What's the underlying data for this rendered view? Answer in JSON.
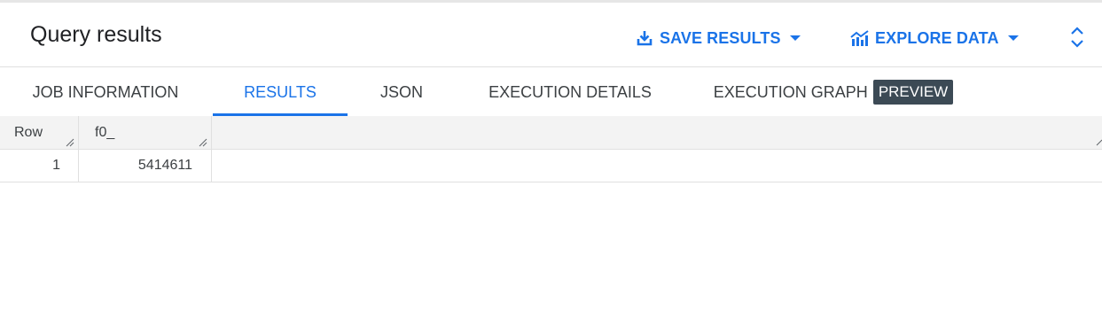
{
  "header": {
    "title": "Query results",
    "save_label": "SAVE RESULTS",
    "explore_label": "EXPLORE DATA"
  },
  "tabs": [
    {
      "label": "JOB INFORMATION",
      "active": false
    },
    {
      "label": "RESULTS",
      "active": true
    },
    {
      "label": "JSON",
      "active": false
    },
    {
      "label": "EXECUTION DETAILS",
      "active": false
    },
    {
      "label": "EXECUTION GRAPH",
      "active": false,
      "badge": "PREVIEW"
    }
  ],
  "table": {
    "columns": [
      "Row",
      "f0_"
    ],
    "rows": [
      [
        "1",
        "5414611"
      ]
    ]
  },
  "icons": {
    "save": "download-icon",
    "explore": "chart-icon",
    "expand": "unfold-icon"
  },
  "colors": {
    "accent": "#1a73e8",
    "badge_bg": "#3c4a55",
    "header_bg": "#f3f3f3"
  }
}
